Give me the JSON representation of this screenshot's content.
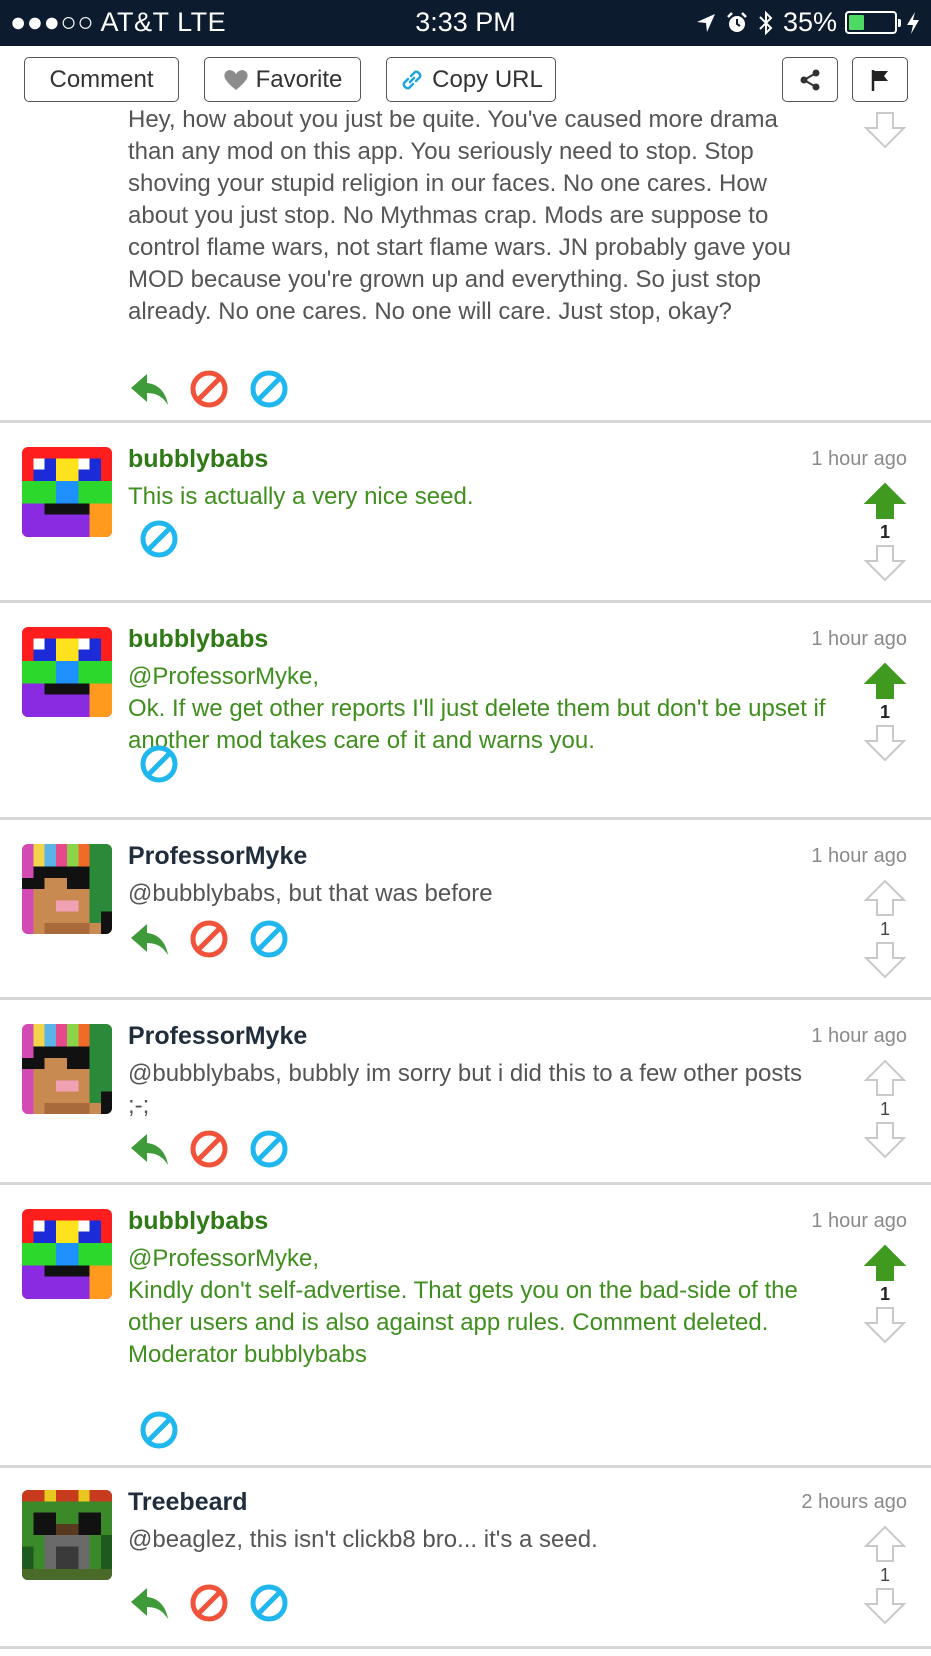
{
  "status_bar": {
    "carrier": "●●●○○ AT&T  LTE",
    "time": "3:33 PM",
    "battery": "35%",
    "battery_level": 0.35
  },
  "toolbar": {
    "comment_label": "Comment",
    "favorite_label": "Favorite",
    "copy_url_label": "Copy URL"
  },
  "first_comment": {
    "body": "Hey, how about you just be quite. You've caused more drama than any mod on this app. You seriously need to stop. Stop shoving your stupid religion in our faces. No one cares. How about you just stop. No Mythmas crap. Mods are suppose to control flame wars, not start flame wars. JN probably gave you MOD because you're grown up and everything. So just stop already. No one cares. No one will care. Just stop, okay?"
  },
  "comments": [
    {
      "username": "bubblybabs",
      "time": "1 hour ago",
      "body": "This is actually a very nice seed.",
      "votes": "1",
      "voted_up": true,
      "role": "moderator"
    },
    {
      "username": "bubblybabs",
      "time": "1 hour ago",
      "body": "@ProfessorMyke,\nOk. If we get other reports I'll just delete them but don't be upset if another mod takes care of it and warns you.",
      "votes": "1",
      "voted_up": true,
      "role": "moderator"
    },
    {
      "username": "ProfessorMyke",
      "time": "1 hour ago",
      "body": "@bubblybabs, but that was before",
      "votes": "1",
      "voted_up": false,
      "role": "user"
    },
    {
      "username": "ProfessorMyke",
      "time": "1 hour ago",
      "body": "@bubblybabs, bubbly im sorry but i did this to a few other posts ;-;",
      "votes": "1",
      "voted_up": false,
      "role": "user"
    },
    {
      "username": "bubblybabs",
      "time": "1 hour ago",
      "body": "@ProfessorMyke,\nKindly don't self-advertise. That gets you on the bad-side of the other users and is also against app rules. Comment deleted.\nModerator bubblybabs",
      "votes": "1",
      "voted_up": true,
      "role": "moderator"
    },
    {
      "username": "Treebeard",
      "time": "2 hours ago",
      "body": "@beaglez, this isn't clickb8 bro... it's a seed.",
      "votes": "1",
      "voted_up": false,
      "role": "user"
    }
  ],
  "colors": {
    "status_bar_bg": "#0d1b2e",
    "moderator_text": "#3f8f1e",
    "upvote_active": "#3f9a1f",
    "reply_icon": "#3f9a3a",
    "ban_icon": "#f0523a",
    "edit_icon": "#1fb7ee"
  },
  "icons": {
    "location": "location-arrow-icon",
    "alarm": "alarm-icon",
    "bluetooth": "bluetooth-icon",
    "charging": "lightning-icon",
    "favorite": "heart-icon",
    "copy_url": "link-icon",
    "share": "share-icon",
    "report": "flag-icon",
    "reply": "reply-icon",
    "ban": "ban-icon",
    "edit": "edit-icon",
    "upvote": "upvote-arrow-icon",
    "downvote": "downvote-arrow-icon"
  }
}
